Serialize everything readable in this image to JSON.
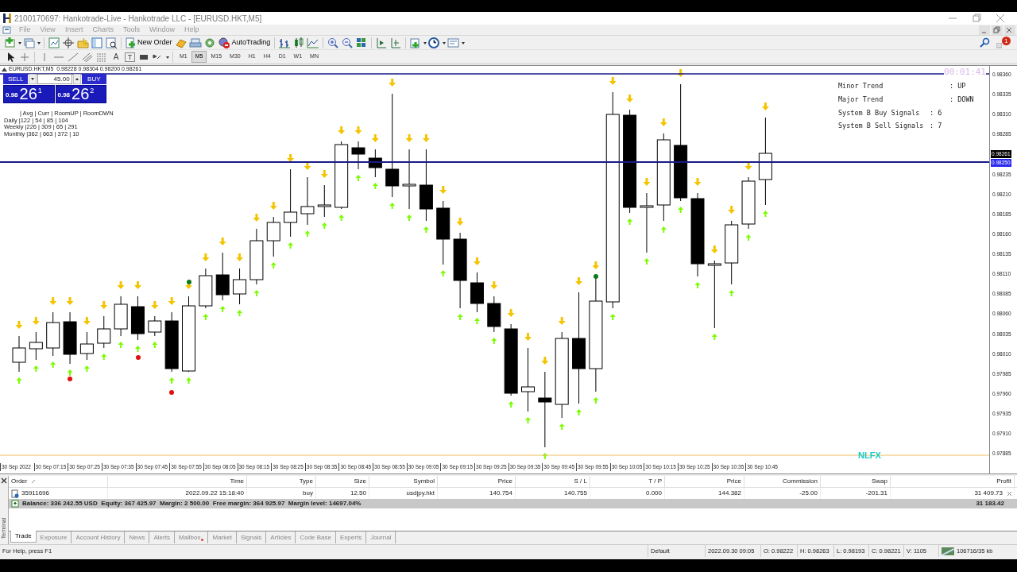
{
  "window": {
    "title": "2100170697: Hankotrade-Live - Hankotrade LLC - [EURUSD.HKT,M5]"
  },
  "menu": [
    "File",
    "View",
    "Insert",
    "Charts",
    "Tools",
    "Window",
    "Help"
  ],
  "toolbar": {
    "new_order": "New Order",
    "auto_trading": "AutoTrading",
    "notifications": "1"
  },
  "drawing_tools": {
    "text_tool": "A",
    "label_tool": "T"
  },
  "timeframes": [
    {
      "label": "M1",
      "selected": false
    },
    {
      "label": "M5",
      "selected": true
    },
    {
      "label": "M15",
      "selected": false
    },
    {
      "label": "M30",
      "selected": false
    },
    {
      "label": "H1",
      "selected": false
    },
    {
      "label": "H4",
      "selected": false
    },
    {
      "label": "D1",
      "selected": false
    },
    {
      "label": "W1",
      "selected": false
    },
    {
      "label": "MN",
      "selected": false
    }
  ],
  "chart": {
    "header": "EURUSD.HKT,M5  0.98228 0.98304 0.98200 0.98261",
    "one_click": {
      "sell": {
        "label": "SELL",
        "small": "0.98",
        "big": "26",
        "sup": "1"
      },
      "lots": "45.00",
      "buy": {
        "label": "BUY",
        "small": "0.98",
        "big": "26",
        "sup": "2"
      }
    },
    "stats": [
      "| Avg | Curr | RoomUP | RoomDWN",
      "Daily |122 | 54 | 85 | 104",
      "Weekly |226 | 309 | 65 | 291",
      "Monthly |362 | 663 | 372 | 10"
    ],
    "timer": "00:01:41",
    "info": [
      {
        "label": "Minor Trend",
        "value": ": UP"
      },
      {
        "label": "Major Trend",
        "value": ": DOWN"
      },
      {
        "label": "System B Buy Signals",
        "value": ": 6"
      },
      {
        "label": "System B Sell Signals",
        "value": ": 7"
      }
    ],
    "watermark_label": "NLFX",
    "price_ticks": [
      "0.98360",
      "0.98335",
      "0.98310",
      "0.98285",
      "0.98235",
      "0.98210",
      "0.98185",
      "0.98160",
      "0.98135",
      "0.98110",
      "0.98085",
      "0.98060",
      "0.98035",
      "0.98010",
      "0.97985",
      "0.97960",
      "0.97935",
      "0.97910",
      "0.97885"
    ],
    "bid_tag": "0.98261",
    "level_tag": "0.98250",
    "time_labels": [
      "30 Sep 2022",
      "30 Sep 07:15",
      "30 Sep 07:25",
      "30 Sep 07:35",
      "30 Sep 07:45",
      "30 Sep 07:55",
      "30 Sep 08:05",
      "30 Sep 08:15",
      "30 Sep 08:25",
      "30 Sep 08:35",
      "30 Sep 08:45",
      "30 Sep 08:55",
      "30 Sep 09:05",
      "30 Sep 09:15",
      "30 Sep 09:25",
      "30 Sep 09:35",
      "30 Sep 09:45",
      "30 Sep 09:55",
      "30 Sep 10:05",
      "30 Sep 10:15",
      "30 Sep 10:25",
      "30 Sep 10:35",
      "30 Sep 10:45"
    ]
  },
  "terminal": {
    "label": "Terminal",
    "columns": [
      "Order",
      "Time",
      "Type",
      "Size",
      "Symbol",
      "Price",
      "S / L",
      "T / P",
      "Price",
      "Commission",
      "Swap",
      "Profit"
    ],
    "rows": [
      [
        "35911696",
        "2022.09.22 15:18:40",
        "buy",
        "12.50",
        "usdjpy.hkt",
        "140.754",
        "140.755",
        "0.000",
        "144.382",
        "-25.00",
        "-201.31",
        "31 409.73"
      ]
    ],
    "summary": "Balance: 336 242.55 USD  Equity: 367 425.97  Margin: 2 500.00  Free margin: 364 925.97  Margin level: 14697.04%",
    "total": "31 183.42",
    "tabs": [
      {
        "label": "Trade",
        "selected": true
      },
      {
        "label": "Exposure",
        "selected": false
      },
      {
        "label": "Account History",
        "selected": false
      },
      {
        "label": "News",
        "selected": false
      },
      {
        "label": "Alerts",
        "selected": false
      },
      {
        "label": "Mailbox",
        "selected": false,
        "unread": true
      },
      {
        "label": "Market",
        "selected": false
      },
      {
        "label": "Signals",
        "selected": false
      },
      {
        "label": "Articles",
        "selected": false
      },
      {
        "label": "Code Base",
        "selected": false
      },
      {
        "label": "Experts",
        "selected": false
      },
      {
        "label": "Journal",
        "selected": false
      }
    ]
  },
  "status_bar": [
    "For Help, press F1",
    "Default",
    "2022.09.30 09:05",
    "O: 0.98222",
    "H: 0.98263",
    "L: 0.98193",
    "C: 0.98221",
    "V: 1105",
    "106716/35 kb"
  ]
}
